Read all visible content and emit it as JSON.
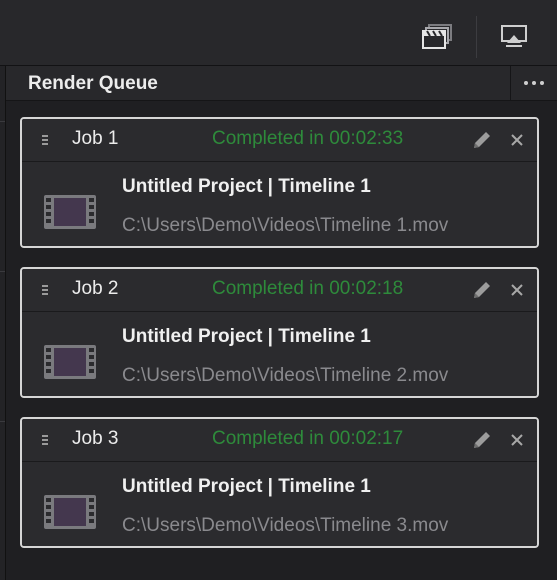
{
  "toolbar": {
    "icons": [
      "clapperboard-stack-icon",
      "monitor-output-icon"
    ]
  },
  "panel": {
    "title": "Render Queue"
  },
  "jobs": [
    {
      "name": "Job 1",
      "status": "Completed in 00:02:33",
      "title": "Untitled Project | Timeline 1",
      "path": "C:\\Users\\Demo\\Videos\\Timeline 1.mov"
    },
    {
      "name": "Job 2",
      "status": "Completed in 00:02:18",
      "title": "Untitled Project | Timeline 1",
      "path": "C:\\Users\\Demo\\Videos\\Timeline 2.mov"
    },
    {
      "name": "Job 3",
      "status": "Completed in 00:02:17",
      "title": "Untitled Project | Timeline 1",
      "path": "C:\\Users\\Demo\\Videos\\Timeline 3.mov"
    }
  ],
  "colors": {
    "status_completed": "#2e8b3b",
    "card_border": "#d6d6d6",
    "background": "#1f1f22"
  }
}
